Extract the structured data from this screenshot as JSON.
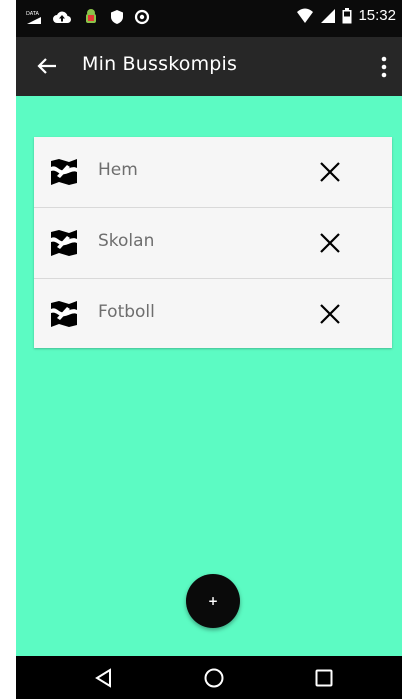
{
  "status_bar": {
    "time": "15:32",
    "icons": [
      "data-icon",
      "cloud-upload-icon",
      "android-icon",
      "shield-icon",
      "sync-icon",
      "wifi-icon",
      "cell-signal-icon",
      "battery-icon"
    ]
  },
  "app_bar": {
    "title": "Min Busskompis",
    "back_icon": "arrow-back-icon",
    "menu_icon": "more-vert-icon"
  },
  "locations": {
    "items": [
      {
        "label": "Hem"
      },
      {
        "label": "Skolan"
      },
      {
        "label": "Fotboll"
      }
    ]
  },
  "fab": {
    "label": "+"
  },
  "nav_bar": {
    "icons": [
      "nav-back-icon",
      "nav-home-icon",
      "nav-recents-icon"
    ]
  },
  "colors": {
    "background": "#5cfbc3",
    "app_bar": "#272727",
    "status_bar": "#0b0b0b",
    "card": "#f6f6f6",
    "fab": "#0a0a0a"
  }
}
